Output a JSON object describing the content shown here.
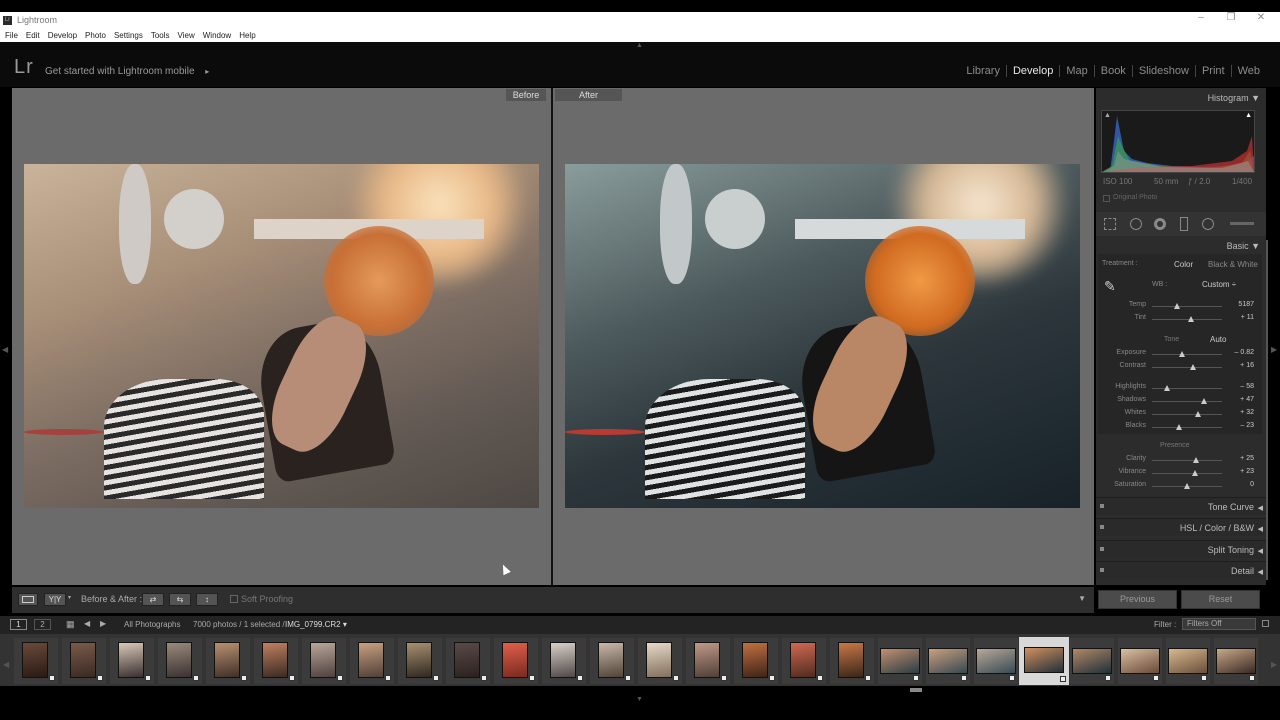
{
  "window": {
    "title": "Lightroom",
    "controls": [
      "–",
      "❐",
      "✕"
    ]
  },
  "menu": [
    "File",
    "Edit",
    "Develop",
    "Photo",
    "Settings",
    "Tools",
    "View",
    "Window",
    "Help"
  ],
  "identity": {
    "logo": "Lr",
    "getstarted": "Get started with Lightroom mobile",
    "arrow": "▸"
  },
  "modules": [
    {
      "label": "Library",
      "active": false
    },
    {
      "label": "Develop",
      "active": true
    },
    {
      "label": "Map",
      "active": false
    },
    {
      "label": "Book",
      "active": false
    },
    {
      "label": "Slideshow",
      "active": false
    },
    {
      "label": "Print",
      "active": false
    },
    {
      "label": "Web",
      "active": false
    }
  ],
  "viewer": {
    "before_label": "Before",
    "after_label": "After"
  },
  "toolbar": {
    "loupe_icon": "loupe-view-icon",
    "yy": "Y|Y",
    "mode": "Before & After :",
    "soft_proofing": "Soft Proofing",
    "menu_arrow": "▼"
  },
  "histogram": {
    "title": "Histogram",
    "iso": "ISO 100",
    "focal": "50 mm",
    "aperture": "ƒ / 2.0",
    "shutter": "1/400",
    "original_photo": "Original Photo"
  },
  "basic": {
    "title": "Basic",
    "treatment_label": "Treatment :",
    "treatment_color": "Color",
    "treatment_bw": "Black & White",
    "wb_label": "WB :",
    "wb_value": "Custom ÷",
    "tone_label": "Tone",
    "auto_label": "Auto",
    "presence_label": "Presence",
    "wb_sliders": [
      {
        "name": "Temp",
        "value": "5187",
        "pos": 0.35
      },
      {
        "name": "Tint",
        "value": "+ 11",
        "pos": 0.55
      }
    ],
    "tone_sliders": [
      {
        "name": "Exposure",
        "value": "– 0.82",
        "pos": 0.43
      },
      {
        "name": "Contrast",
        "value": "+ 16",
        "pos": 0.58
      }
    ],
    "tone_sliders2": [
      {
        "name": "Highlights",
        "value": "– 58",
        "pos": 0.21
      },
      {
        "name": "Shadows",
        "value": "+ 47",
        "pos": 0.74
      },
      {
        "name": "Whites",
        "value": "+ 32",
        "pos": 0.66
      },
      {
        "name": "Blacks",
        "value": "– 23",
        "pos": 0.39
      }
    ],
    "presence_sliders": [
      {
        "name": "Clarity",
        "value": "+ 25",
        "pos": 0.63
      },
      {
        "name": "Vibrance",
        "value": "+ 23",
        "pos": 0.62
      },
      {
        "name": "Saturation",
        "value": "0",
        "pos": 0.5
      }
    ]
  },
  "sections": [
    "Tone Curve",
    "HSL / Color / B&W",
    "Split Toning",
    "Detail"
  ],
  "buttons": {
    "previous": "Previous",
    "reset": "Reset"
  },
  "filmstrip": {
    "page1": "1",
    "page2": "2",
    "source": "All Photographs",
    "count": "7000 photos / 1 selected /",
    "filename": "IMG_0799.CR2",
    "filter_label": "Filter :",
    "filter_value": "Filters Off"
  },
  "colors": {
    "accent": "#e8e8e8",
    "panel": "#2c2c2c",
    "viewer_bg": "#6b6b6b"
  }
}
